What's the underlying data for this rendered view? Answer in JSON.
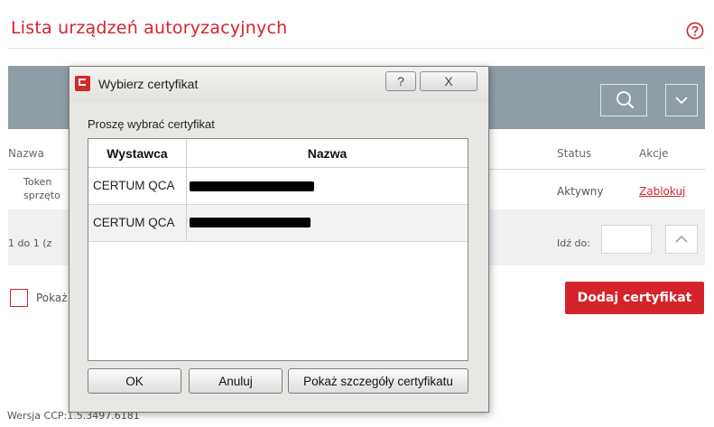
{
  "page": {
    "title": "Lista urządzeń autoryzacyjnych",
    "help_icon": "question-circle-icon",
    "search_icon": "search-icon",
    "dropdown_icon": "chevron-down-icon",
    "columns": [
      "Nazwa",
      "Status",
      "Akcje"
    ],
    "row": {
      "name_line1": "Token",
      "name_line2": "sprzęto",
      "status": "Aktywny",
      "action": "Zablokuj"
    },
    "pager": {
      "range_text": "1 do 1 (z",
      "goto_label": "Idź do:",
      "goto_value": "",
      "up_icon": "chevron-up-icon"
    },
    "show_checkbox_label": "Pokaż",
    "add_button": "Dodaj certyfikat",
    "version": "Wersja CCP:1.5.3497.6181",
    "accent_color": "#d4232b"
  },
  "dialog": {
    "title": "Wybierz certyfikat",
    "app_icon": "app-icon",
    "help_button": "?",
    "close_button": "X",
    "prompt": "Proszę wybrać certyfikat",
    "columns": {
      "issuer": "Wystawca",
      "name": "Nazwa"
    },
    "certificates": [
      {
        "issuer": "CERTUM QCA",
        "name": ""
      },
      {
        "issuer": "CERTUM QCA",
        "name": ""
      }
    ],
    "buttons": {
      "ok": "OK",
      "cancel": "Anuluj",
      "details": "Pokaż szczegóły certyfikatu"
    }
  }
}
